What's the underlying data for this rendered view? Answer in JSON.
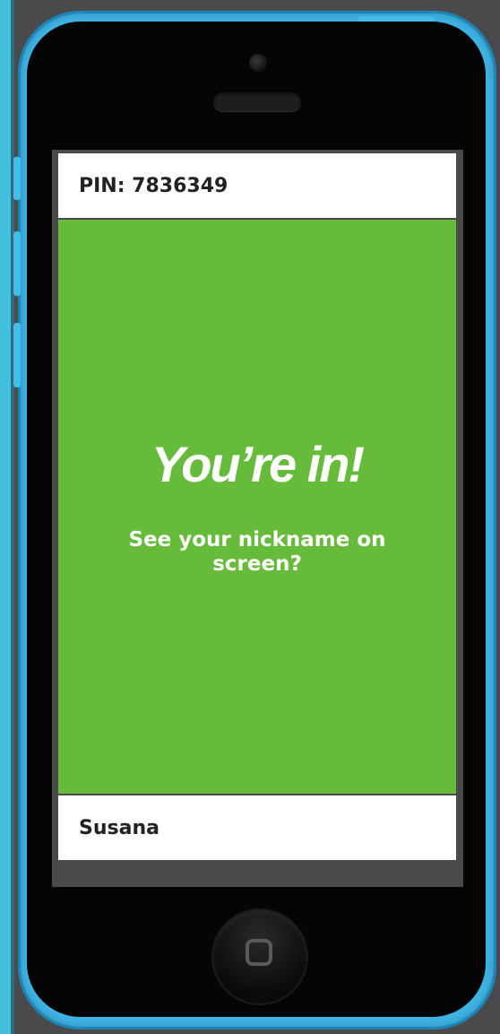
{
  "session": {
    "pin_text": "PIN: 7836349"
  },
  "status": {
    "headline": "You’re in!",
    "message": "See your nickname on screen?"
  },
  "player": {
    "nickname": "Susana"
  },
  "colors": {
    "accent_green": "#66bb3a",
    "phone_case_blue": "#3fb4e6"
  }
}
